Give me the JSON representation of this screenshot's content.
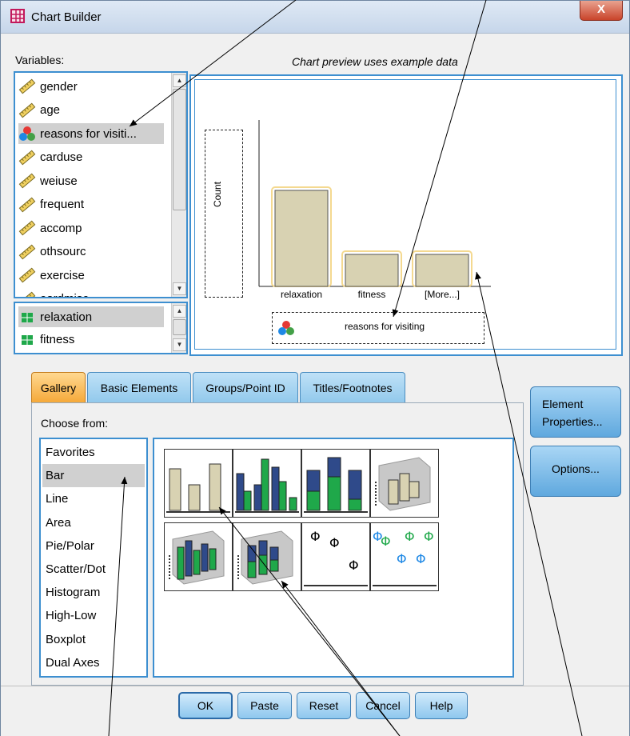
{
  "window": {
    "title": "Chart Builder",
    "close_glyph": "X"
  },
  "variables": {
    "label": "Variables:",
    "items": [
      {
        "name": "gender",
        "icon": "scale-ruler-icon"
      },
      {
        "name": "age",
        "icon": "scale-ruler-icon"
      },
      {
        "name": "reasons for visiti...",
        "icon": "multiple-response-set-icon",
        "selected": true
      },
      {
        "name": "carduse",
        "icon": "scale-ruler-icon"
      },
      {
        "name": "weiuse",
        "icon": "scale-ruler-icon"
      },
      {
        "name": "frequent",
        "icon": "scale-ruler-icon"
      },
      {
        "name": "accomp",
        "icon": "scale-ruler-icon"
      },
      {
        "name": "othsourc",
        "icon": "scale-ruler-icon"
      },
      {
        "name": "exercise",
        "icon": "scale-ruler-icon"
      },
      {
        "name": "eardmisc",
        "icon": "scale-ruler-icon"
      }
    ]
  },
  "categories_list": {
    "items": [
      {
        "name": "relaxation",
        "selected": true
      },
      {
        "name": "fitness"
      }
    ]
  },
  "preview": {
    "caption": "Chart preview uses example data",
    "y_drop_label": "Count",
    "x_drop_label": "reasons for visiting"
  },
  "chart_data": {
    "type": "bar",
    "categories": [
      "relaxation",
      "fitness",
      "[More...]"
    ],
    "values": [
      3,
      1,
      1
    ],
    "ylabel": "Count",
    "xlabel": "reasons for visiting"
  },
  "tabs": [
    {
      "label": "Gallery",
      "active": true
    },
    {
      "label": "Basic Elements"
    },
    {
      "label": "Groups/Point ID"
    },
    {
      "label": "Titles/Footnotes"
    }
  ],
  "gallery": {
    "choose_label": "Choose from:",
    "choose_items": [
      "Favorites",
      "Bar",
      "Line",
      "Area",
      "Pie/Polar",
      "Scatter/Dot",
      "Histogram",
      "High-Low",
      "Boxplot",
      "Dual Axes"
    ],
    "selected": "Bar",
    "thumbnails": [
      "simple-bar-thumbnail",
      "clustered-bar-thumbnail",
      "stacked-bar-thumbnail",
      "simple-3d-bar-thumbnail",
      "clustered-3d-bar-thumbnail",
      "stacked-3d-bar-thumbnail",
      "simple-error-bar-thumbnail",
      "clustered-error-bar-thumbnail"
    ]
  },
  "side_buttons": {
    "element_line1": "Element",
    "element_line2": "Properties...",
    "options": "Options..."
  },
  "footer": {
    "ok": "OK",
    "paste": "Paste",
    "reset": "Reset",
    "cancel": "Cancel",
    "help": "Help"
  },
  "colors": {
    "bar_fill": "#d8d2b2",
    "bar_highlight": "#f4d990",
    "border_blue": "#3d8fd0",
    "tab_active": "#f5a93a",
    "button_blue": "#8ec7ee",
    "series_navy": "#2f4a8a",
    "series_green": "#1fa84a"
  }
}
